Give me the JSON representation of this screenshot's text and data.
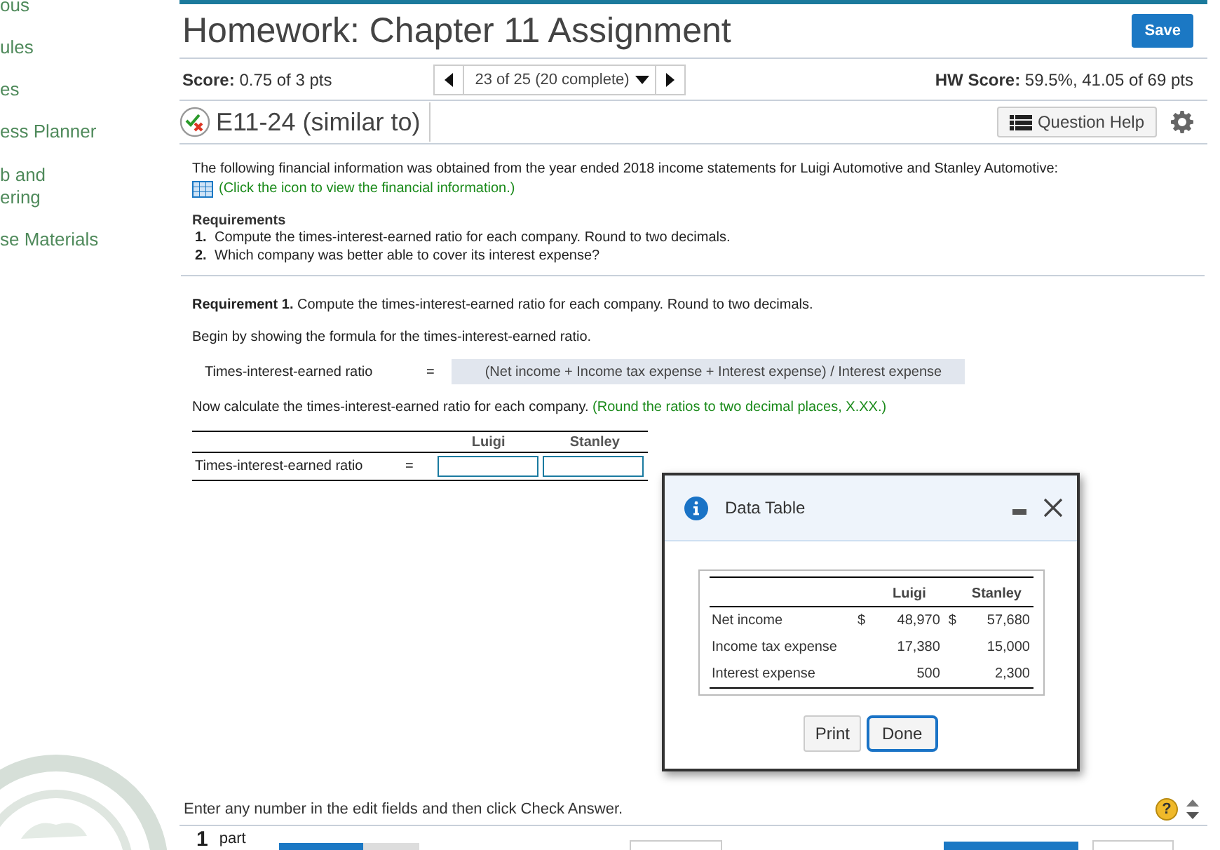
{
  "sidebar": {
    "items": [
      {
        "lines": [
          "ous"
        ]
      },
      {
        "lines": [
          "ules"
        ]
      },
      {
        "lines": [
          "es"
        ]
      },
      {
        "lines": [
          "ess Planner"
        ]
      },
      {
        "lines": [
          "b and",
          "ering"
        ]
      },
      {
        "lines": [
          "se Materials"
        ]
      }
    ]
  },
  "header": {
    "title": "Homework: Chapter 11 Assignment",
    "save": "Save"
  },
  "score_bar": {
    "score_label": "Score:",
    "score": "0.75 of 3 pts",
    "position": "23 of 25 (20 complete)",
    "hw_label": "HW Score:",
    "hw_score": "59.5%, 41.05 of 69 pts"
  },
  "question": {
    "title": "E11-24 (similar to)",
    "help": "Question Help"
  },
  "content": {
    "intro": "The following financial information was obtained from the year ended 2018 income statements for Luigi Automotive and Stanley Automotive:",
    "link": "(Click the icon to view the financial information.)",
    "requirements_title": "Requirements",
    "requirements": [
      {
        "number": "1.",
        "text": "Compute the times-interest-earned ratio for each company. Round to two decimals."
      },
      {
        "number": "2.",
        "text": "Which company was better able to cover its interest expense?"
      }
    ],
    "req1": "**Requirement 1.** Compute the times-interest-earned ratio for each company. Round to two decimals.",
    "begin": "Begin by showing the formula for the times-interest-earned ratio.",
    "formula": {
      "label": "Times-interest-earned ratio",
      "equals": "=",
      "value": "(Net income + Income tax expense + Interest expense) / Interest expense"
    },
    "calc": "Now calculate the times-interest-earned ratio for each company.",
    "calc_hint": "(Round the ratios to two decimal places, X.XX.)",
    "answer_table": {
      "columns": [
        "Luigi",
        "Stanley"
      ],
      "row_label": "Times-interest-earned ratio",
      "equals": "="
    }
  },
  "dialog": {
    "title": "Data Table",
    "columns": [
      "Luigi",
      "Stanley"
    ],
    "rows": [
      {
        "label": "Net income",
        "currency_1": "$",
        "value_1": "48,970",
        "currency_2": "$",
        "value_2": "57,680"
      },
      {
        "label": "Income tax expense",
        "value_1": "17,380",
        "value_2": "15,000"
      },
      {
        "label": "Interest expense",
        "value_1": "500",
        "value_2": "2,300"
      }
    ],
    "buttons": [
      {
        "label": "Print",
        "focused": false
      },
      {
        "label": "Done",
        "focused": true
      }
    ]
  },
  "footer": {
    "instruction": "Enter any number in the edit fields and then click Check Answer.",
    "help": "?",
    "parts_count": "1",
    "parts_label": "part",
    "progress": {
      "level": 0.6
    }
  }
}
